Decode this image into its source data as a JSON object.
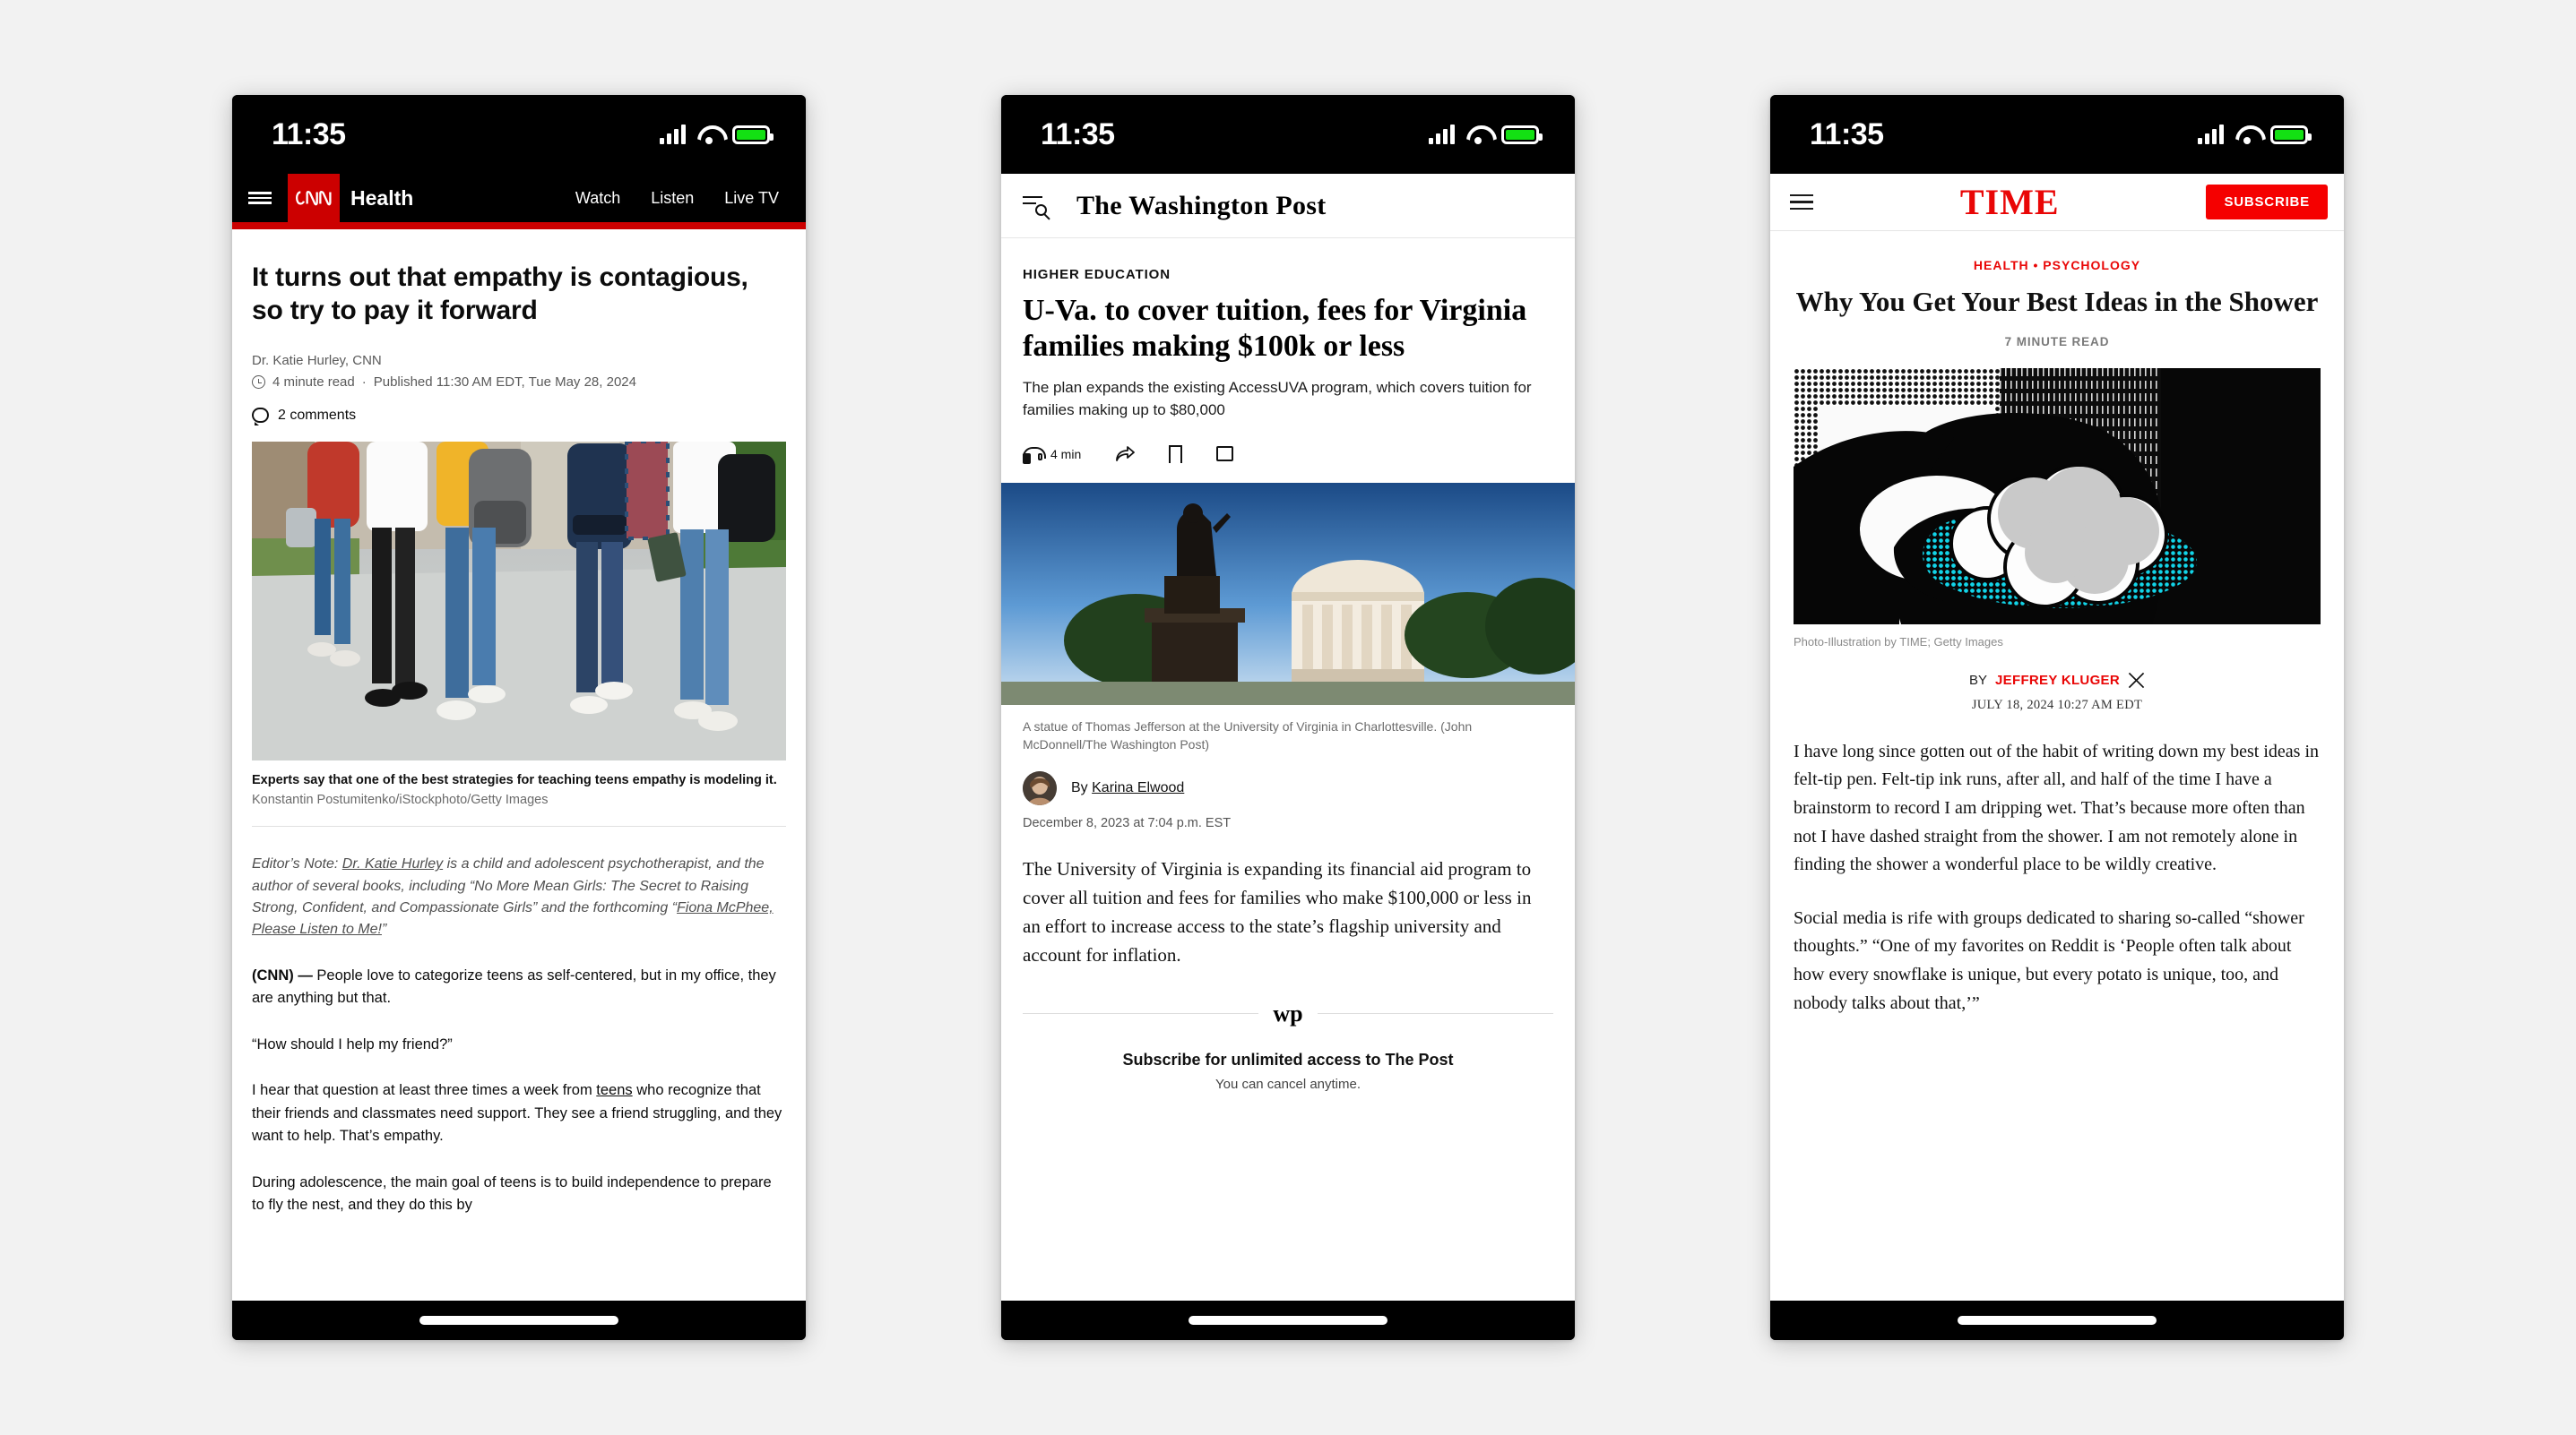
{
  "background_color": "#f2f2f2",
  "status_bar": {
    "time": "11:35",
    "signal_icon": "cellular-bars-icon",
    "wifi_icon": "wifi-icon",
    "battery_icon": "battery-full-icon"
  },
  "phones": [
    {
      "id": "cnn",
      "brand_color": "#cc0000",
      "nav": {
        "menu_icon": "hamburger-menu-icon",
        "logo": "CNN",
        "section": "Health",
        "links": [
          "Watch",
          "Listen",
          "Live TV"
        ]
      },
      "article": {
        "headline": "It turns out that empathy is contagious, so try to pay it forward",
        "author": "Dr. Katie Hurley, CNN",
        "read_time": "4 minute read",
        "separator": "·",
        "published": "Published 11:30 AM EDT, Tue May 28, 2024",
        "comments": "2 comments",
        "photo_alt": "Five teens with backpacks walking away from camera on a campus path",
        "caption_bold": "Experts say that one of the best strategies for teaching teens empathy is modeling it.",
        "caption_credit": "Konstantin Postumitenko/iStockphoto/Getty Images",
        "editors_note_pre": "Editor’s Note: ",
        "editors_note_link1": "Dr. Katie Hurley",
        "editors_note_mid": " is a child and adolescent psychotherapist, and the author of several books, including “No More Mean Girls: The Secret to Raising Strong, Confident, and Compassionate Girls” and the forthcoming “",
        "editors_note_link2": "Fiona McPhee, Please Listen to Me!",
        "editors_note_post": "”",
        "paragraphs": [
          {
            "lead": "(CNN) — ",
            "text": "People love to categorize teens as self-centered, but in my office, they are anything but that."
          },
          {
            "lead": "",
            "text": "“How should I help my friend?”"
          },
          {
            "lead": "",
            "text": "I hear that question at least three times a week from ",
            "link": "teens",
            "text_after": " who recognize that their friends and classmates need support. They see a friend struggling, and they want to help. That’s empathy."
          },
          {
            "lead": "",
            "text": "During adolescence, the main goal of teens is to build independence to prepare to fly the nest, and they do this by"
          }
        ]
      }
    },
    {
      "id": "washingtonpost",
      "nav": {
        "menu_search_icon": "menu-search-icon",
        "masthead": "The Washington Post"
      },
      "article": {
        "kicker": "HIGHER EDUCATION",
        "headline": "U-Va. to cover tuition, fees for Virginia families making $100k or less",
        "deck": "The plan expands the existing AccessUVA program, which covers tuition for families making up to $80,000",
        "actions": [
          {
            "icon": "headphones-icon",
            "label": "4 min"
          },
          {
            "icon": "share-arrow-icon",
            "label": ""
          },
          {
            "icon": "bookmark-icon",
            "label": ""
          },
          {
            "icon": "comment-icon",
            "label": ""
          }
        ],
        "photo_alt": "Statue of Thomas Jefferson in front of the Rotunda at the University of Virginia",
        "caption": "A statue of Thomas Jefferson at the University of Virginia in Charlottesville. (John McDonnell/The Washington Post)",
        "byline_prefix": "By ",
        "byline_author": "Karina Elwood",
        "avatar_icon": "author-avatar",
        "date": "December 8, 2023 at 7:04 p.m. EST",
        "paragraph": "The University of Virginia is expanding its financial aid program to cover all tuition and fees for families who make $100,000 or less in an effort to increase access to the state’s flagship university and account for inflation.",
        "rule_glyph": "wp",
        "subscribe_title": "Subscribe for unlimited access to The Post",
        "subscribe_note": "You can cancel anytime."
      }
    },
    {
      "id": "time",
      "brand_color": "#e90606",
      "nav": {
        "menu_icon": "hamburger-menu-icon",
        "logo": "TIME",
        "subscribe_label": "SUBSCRIBE"
      },
      "article": {
        "kicker": "HEALTH • PSYCHOLOGY",
        "headline": "Why You Get Your Best Ideas in the Shower",
        "read_time": "7 MINUTE READ",
        "photo_alt": "High-contrast halftone photo-illustration of a person in a shower with a thought cloud",
        "credit": "Photo-Illustration by TIME; Getty Images",
        "byline_prefix": "BY ",
        "byline_author": "JEFFREY KLUGER",
        "social_icon": "x-twitter-icon",
        "date": "JULY 18, 2024 10:27 AM EDT",
        "paragraphs": [
          "I have long since gotten out of the habit of writing down my best ideas in felt-tip pen. Felt-tip ink runs, after all, and half of the time I have a brainstorm to record I am dripping wet. That’s because more often than not I have dashed straight from the shower. I am not remotely alone in finding the shower a wonderful place to be wildly creative.",
          "Social media is rife with groups dedicated to sharing so-called “shower thoughts.” “One of my favorites on Reddit is ‘People often talk about how every snowflake is unique, but every potato is unique, too, and nobody talks about that,’”"
        ]
      }
    }
  ]
}
